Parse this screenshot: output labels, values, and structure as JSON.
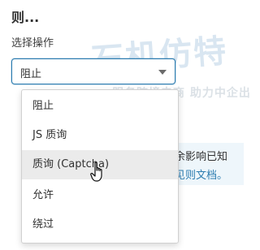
{
  "section": {
    "title": "则..."
  },
  "action": {
    "label": "选择操作",
    "selected": "阻止",
    "options": [
      "阻止",
      "JS 质询",
      "质询 (Captcha)",
      "允许",
      "绕过"
    ],
    "hovered_index": 2
  },
  "background_info": {
    "line1": "余影响已知",
    "line2": "见则文档。"
  },
  "watermark": {
    "big": "石机仿特",
    "sub": "服务跨境电商 助力中企出"
  },
  "colors": {
    "accent": "#2c7cb0",
    "hover": "#ebebeb"
  },
  "cursor_icon": "hand-pointer"
}
